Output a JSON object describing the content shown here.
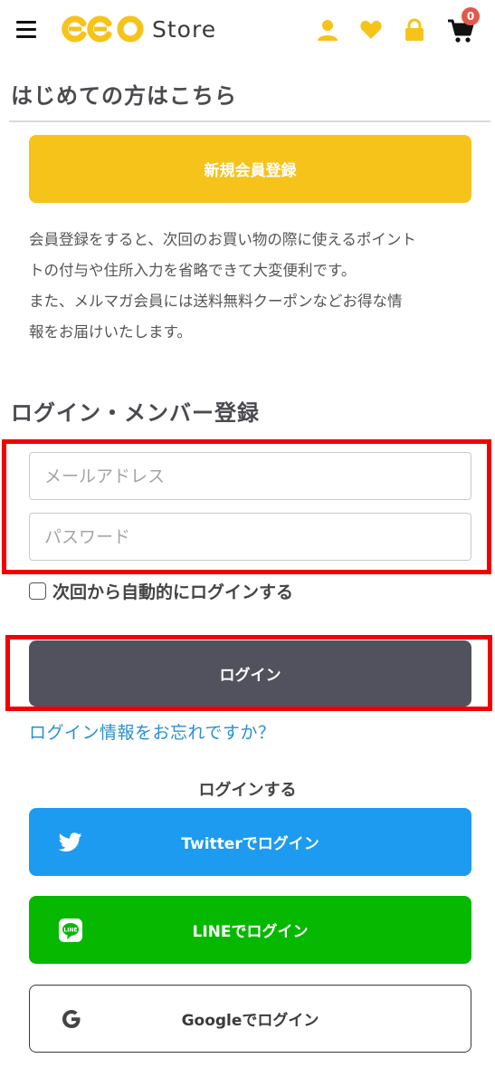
{
  "header": {
    "logo_text": "Store",
    "cart_count": "0",
    "accent_color": "#f6c31b"
  },
  "first_time": {
    "heading": "はじめての方はこちら",
    "register_button": "新規会員登録",
    "description": [
      "会員登録をすると、次回のお買い物の際に使えるポイント",
      "トの付与や住所入力を省略できて大変便利です。",
      "また、メルマガ会員には送料無料クーポンなどお得な情",
      "報をお届けいたします。"
    ]
  },
  "login": {
    "heading": "ログイン・メンバー登録",
    "email_placeholder": "メールアドレス",
    "password_placeholder": "パスワード",
    "remember_label": "次回から自動的にログインする",
    "login_button": "ログイン",
    "forgot_link": "ログイン情報をお忘れですか？"
  },
  "social": {
    "title": "ログインする",
    "twitter": "Twitterでログイン",
    "line": "LINEでログイン",
    "google": "Googleでログイン"
  }
}
